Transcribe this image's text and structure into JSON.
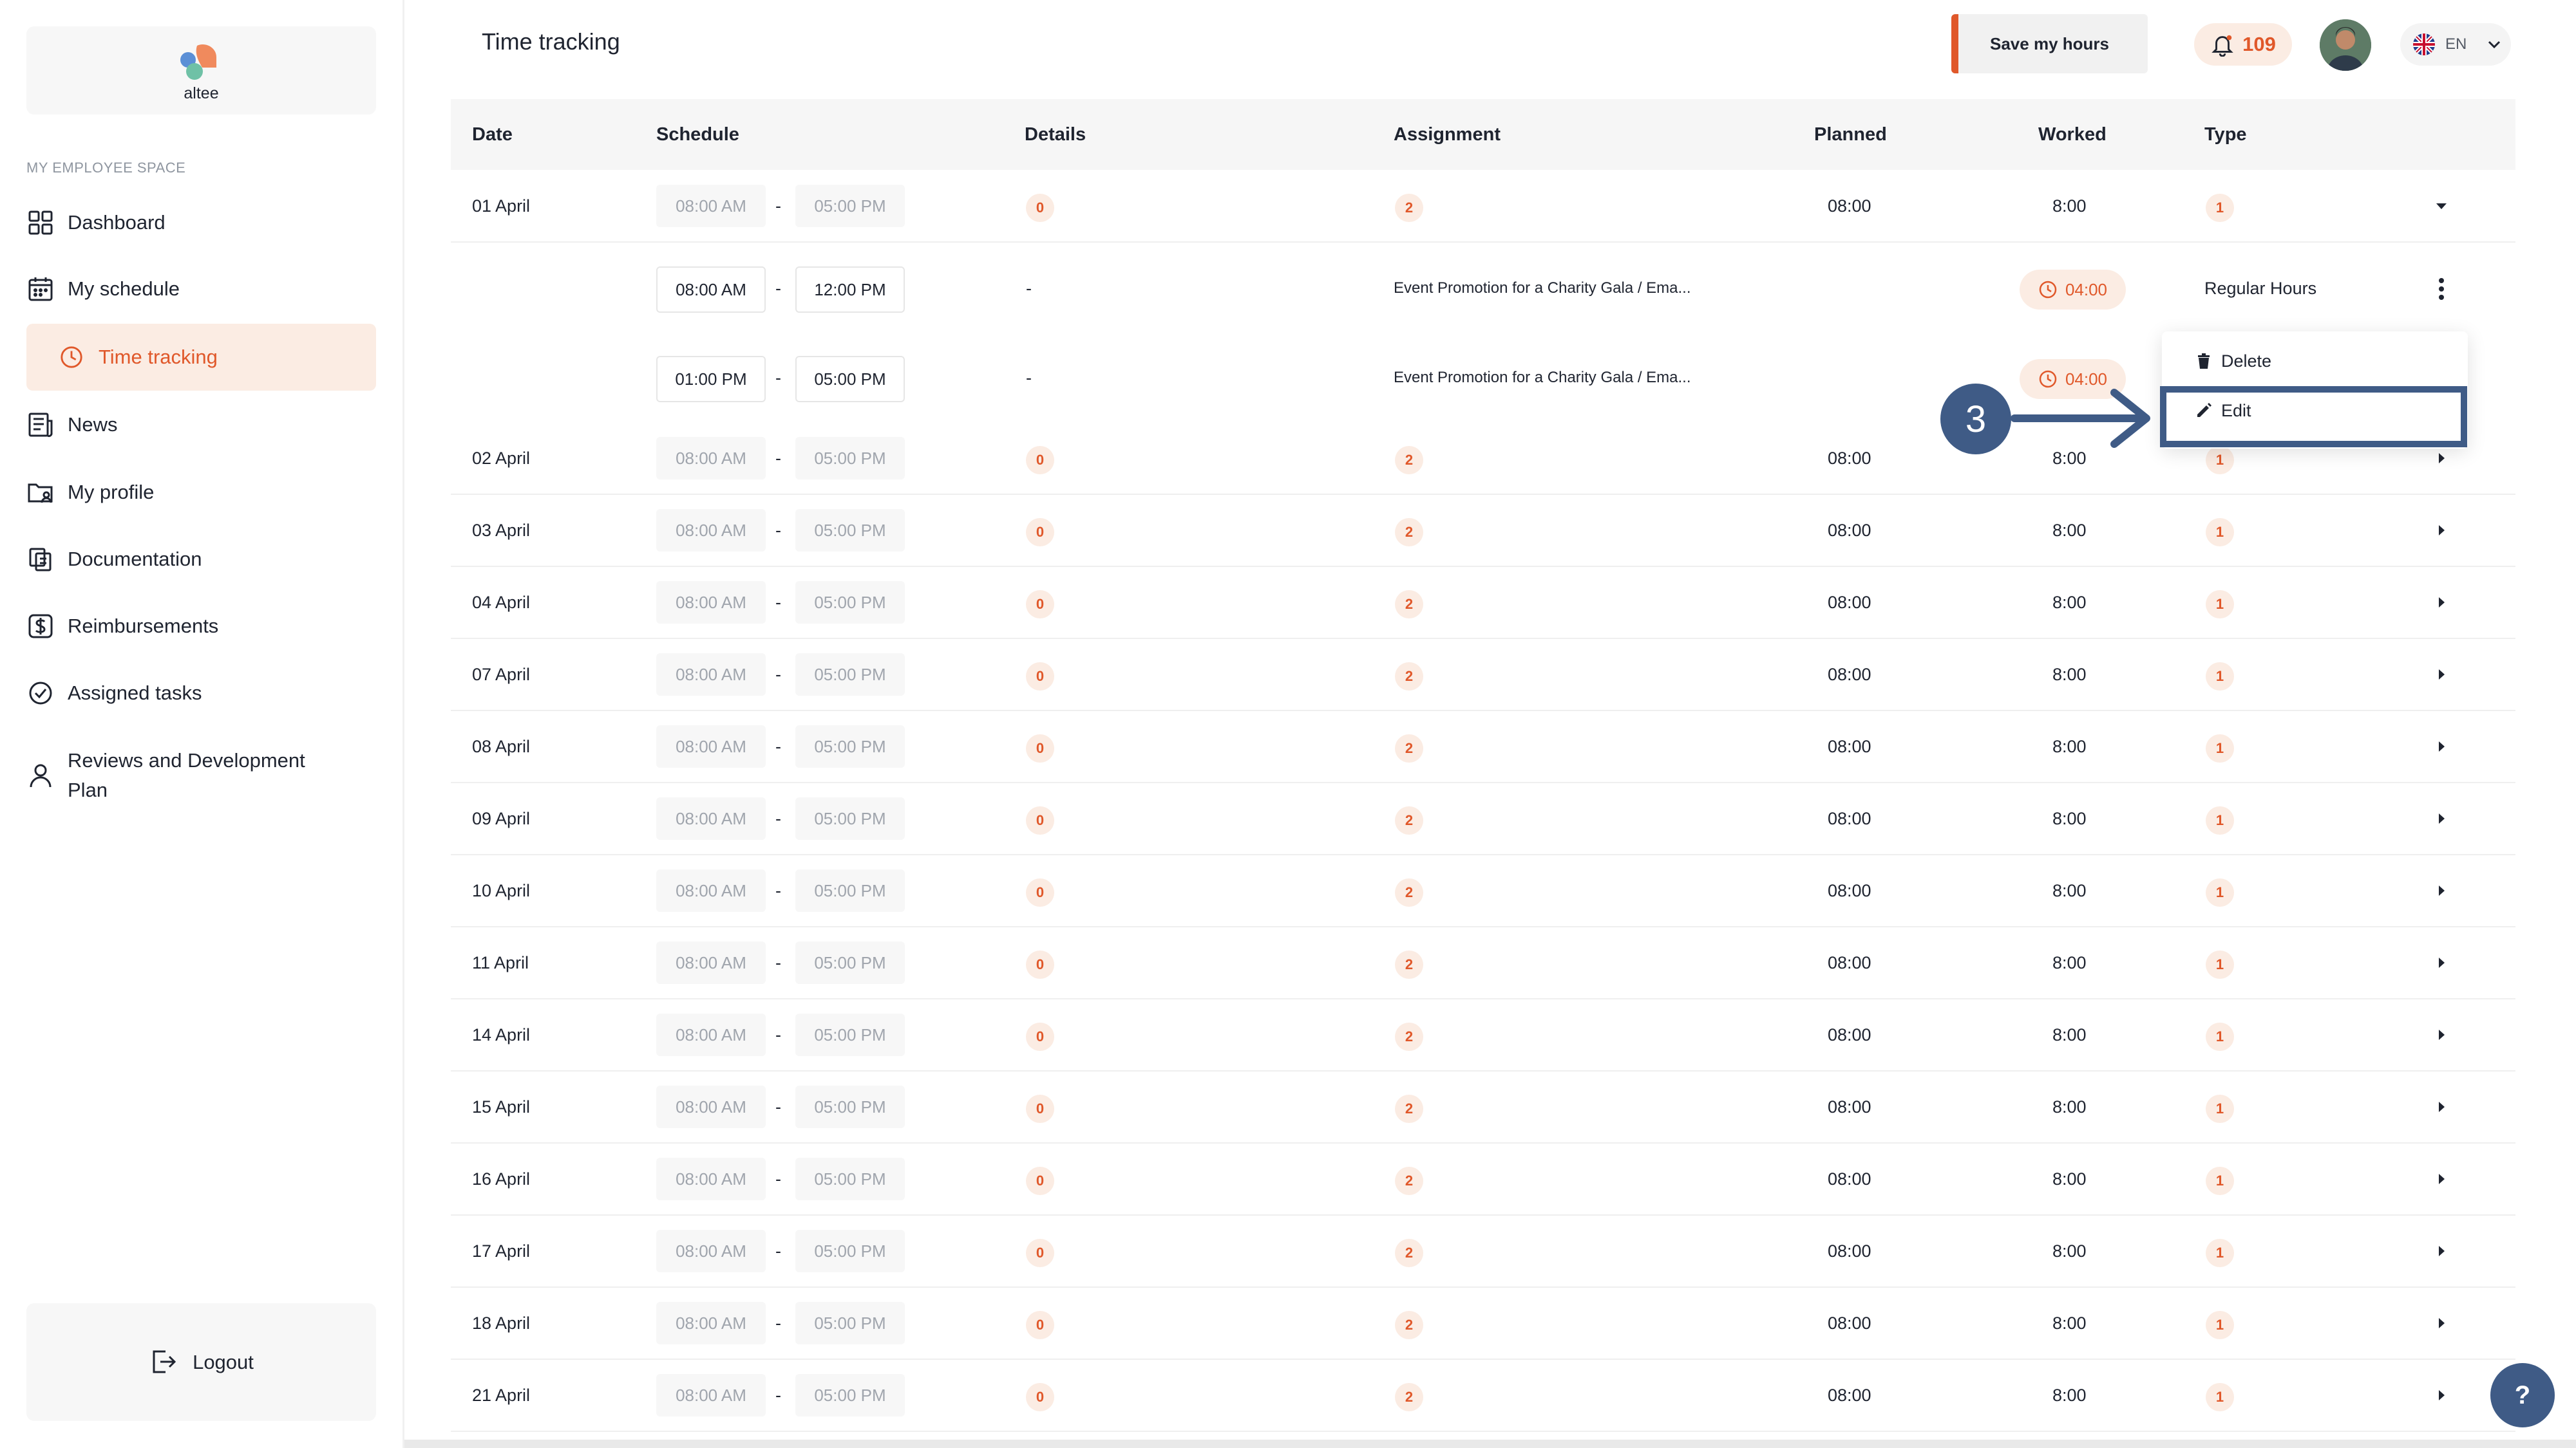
{
  "app": {
    "logo_text": "altee"
  },
  "sidebar": {
    "section_label": "MY EMPLOYEE SPACE",
    "items": [
      {
        "label": "Dashboard",
        "icon": "grid-icon"
      },
      {
        "label": "My schedule",
        "icon": "calendar-icon"
      },
      {
        "label": "Time tracking",
        "icon": "clock-icon",
        "active": true
      },
      {
        "label": "News",
        "icon": "newspaper-icon"
      },
      {
        "label": "My profile",
        "icon": "folder-user-icon"
      },
      {
        "label": "Documentation",
        "icon": "documents-icon"
      },
      {
        "label": "Reimbursements",
        "icon": "dollar-icon"
      },
      {
        "label": "Assigned tasks",
        "icon": "check-circle-icon"
      },
      {
        "label": "Reviews and Development Plan",
        "icon": "user-icon"
      }
    ],
    "logout_label": "Logout"
  },
  "header": {
    "title": "Time tracking",
    "save_label": "Save my hours",
    "notifications_count": "109",
    "language": "EN"
  },
  "table": {
    "columns": [
      "Date",
      "Schedule",
      "Details",
      "Assignment",
      "Planned",
      "Worked",
      "Type"
    ],
    "rows": [
      {
        "date": "01 April",
        "start": "08:00 AM",
        "end": "05:00 PM",
        "details": "0",
        "assignment": "2",
        "planned": "08:00",
        "worked": "8:00",
        "type": "1",
        "expanded": true
      },
      {
        "date": "02 April",
        "start": "08:00 AM",
        "end": "05:00 PM",
        "details": "0",
        "assignment": "2",
        "planned": "08:00",
        "worked": "8:00",
        "type": "1"
      },
      {
        "date": "03 April",
        "start": "08:00 AM",
        "end": "05:00 PM",
        "details": "0",
        "assignment": "2",
        "planned": "08:00",
        "worked": "8:00",
        "type": "1"
      },
      {
        "date": "04 April",
        "start": "08:00 AM",
        "end": "05:00 PM",
        "details": "0",
        "assignment": "2",
        "planned": "08:00",
        "worked": "8:00",
        "type": "1"
      },
      {
        "date": "07 April",
        "start": "08:00 AM",
        "end": "05:00 PM",
        "details": "0",
        "assignment": "2",
        "planned": "08:00",
        "worked": "8:00",
        "type": "1"
      },
      {
        "date": "08 April",
        "start": "08:00 AM",
        "end": "05:00 PM",
        "details": "0",
        "assignment": "2",
        "planned": "08:00",
        "worked": "8:00",
        "type": "1"
      },
      {
        "date": "09 April",
        "start": "08:00 AM",
        "end": "05:00 PM",
        "details": "0",
        "assignment": "2",
        "planned": "08:00",
        "worked": "8:00",
        "type": "1"
      },
      {
        "date": "10 April",
        "start": "08:00 AM",
        "end": "05:00 PM",
        "details": "0",
        "assignment": "2",
        "planned": "08:00",
        "worked": "8:00",
        "type": "1"
      },
      {
        "date": "11 April",
        "start": "08:00 AM",
        "end": "05:00 PM",
        "details": "0",
        "assignment": "2",
        "planned": "08:00",
        "worked": "8:00",
        "type": "1"
      },
      {
        "date": "14 April",
        "start": "08:00 AM",
        "end": "05:00 PM",
        "details": "0",
        "assignment": "2",
        "planned": "08:00",
        "worked": "8:00",
        "type": "1"
      },
      {
        "date": "15 April",
        "start": "08:00 AM",
        "end": "05:00 PM",
        "details": "0",
        "assignment": "2",
        "planned": "08:00",
        "worked": "8:00",
        "type": "1"
      },
      {
        "date": "16 April",
        "start": "08:00 AM",
        "end": "05:00 PM",
        "details": "0",
        "assignment": "2",
        "planned": "08:00",
        "worked": "8:00",
        "type": "1"
      },
      {
        "date": "17 April",
        "start": "08:00 AM",
        "end": "05:00 PM",
        "details": "0",
        "assignment": "2",
        "planned": "08:00",
        "worked": "8:00",
        "type": "1"
      },
      {
        "date": "18 April",
        "start": "08:00 AM",
        "end": "05:00 PM",
        "details": "0",
        "assignment": "2",
        "planned": "08:00",
        "worked": "8:00",
        "type": "1"
      },
      {
        "date": "21 April",
        "start": "08:00 AM",
        "end": "05:00 PM",
        "details": "0",
        "assignment": "2",
        "planned": "08:00",
        "worked": "8:00",
        "type": "1"
      }
    ],
    "subrows": [
      {
        "start": "08:00 AM",
        "end": "12:00 PM",
        "details": "-",
        "assignment": "Event Promotion for a Charity Gala / Ema...",
        "worked": "04:00",
        "type": "Regular Hours"
      },
      {
        "start": "01:00 PM",
        "end": "05:00 PM",
        "details": "-",
        "assignment": "Event Promotion for a Charity Gala / Ema...",
        "worked": "04:00",
        "type": ""
      }
    ],
    "dash": "-"
  },
  "context_menu": {
    "delete_label": "Delete",
    "edit_label": "Edit"
  },
  "annotation": {
    "step": "3"
  },
  "help_label": "?",
  "colors": {
    "accent": "#e0582a",
    "accent_soft": "#fbece3",
    "annotation": "#3f5b86"
  }
}
